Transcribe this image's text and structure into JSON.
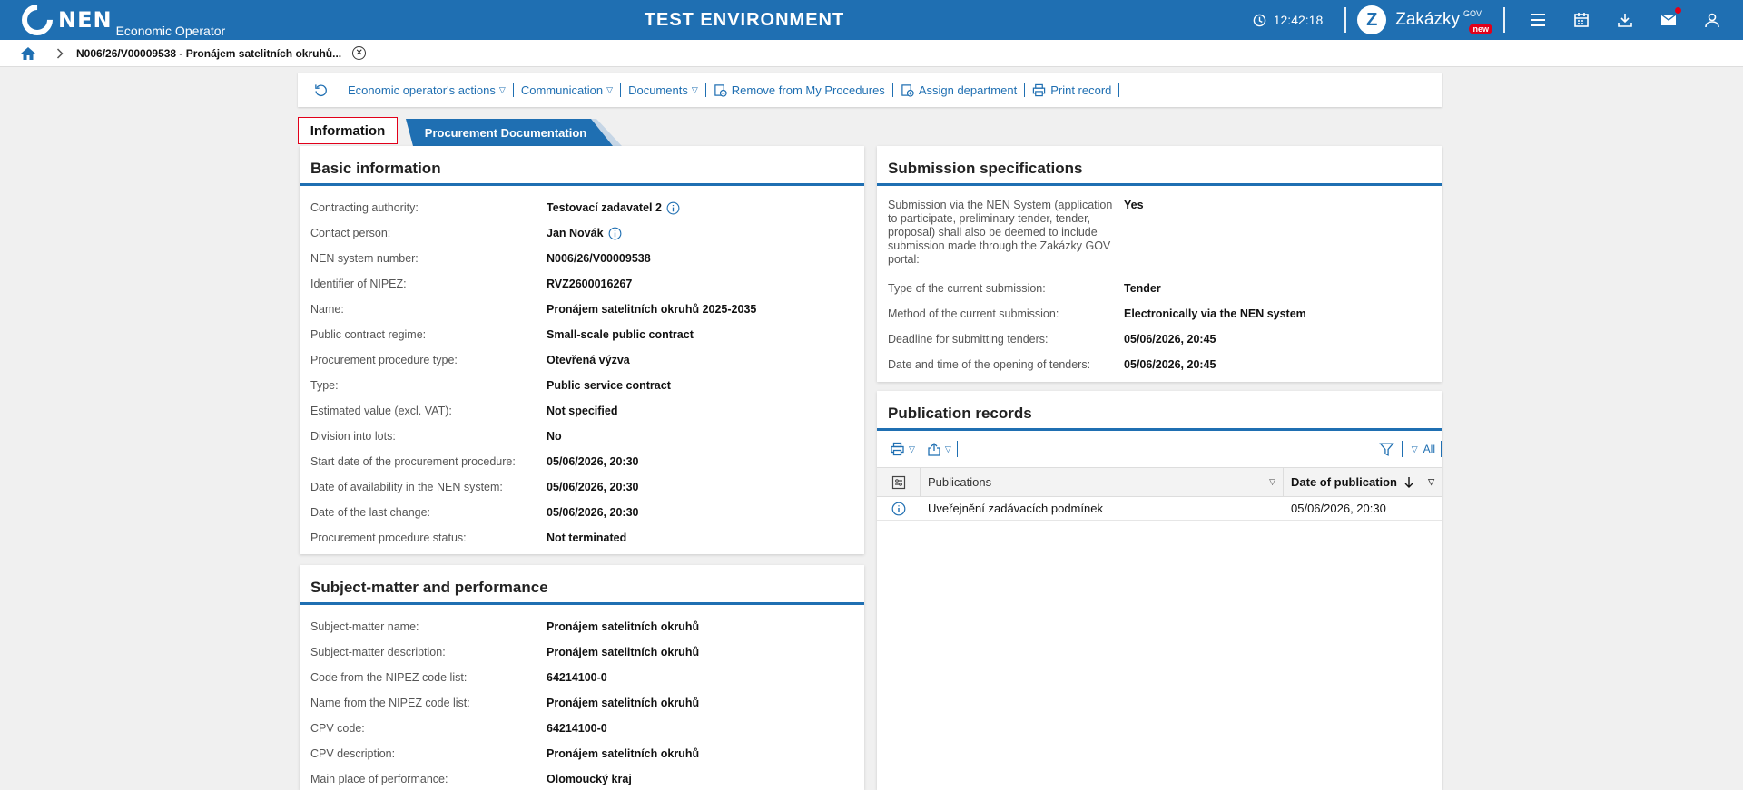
{
  "header": {
    "logo_text": "NEN",
    "logo_sub": "Economic Operator",
    "environment": "TEST ENVIRONMENT",
    "clock": "12:42:18",
    "zakazky_label": "Zakázky",
    "zakazky_gov": "GOV",
    "zakazky_badge": "new"
  },
  "breadcrumb": {
    "title": "N006/26/V00009538 - Pronájem satelitních okruhů..."
  },
  "toolbar": {
    "eo_actions": "Economic operator's actions",
    "communication": "Communication",
    "documents": "Documents",
    "remove": "Remove from My Procedures",
    "assign": "Assign department",
    "print": "Print record"
  },
  "tabs": {
    "information": "Information",
    "documentation": "Procurement Documentation"
  },
  "basic": {
    "title": "Basic information",
    "rows": [
      {
        "label": "Contracting authority:",
        "value": "Testovací zadavatel 2"
      },
      {
        "label": "Contact person:",
        "value": "Jan Novák"
      },
      {
        "label": "NEN system number:",
        "value": "N006/26/V00009538"
      },
      {
        "label": "Identifier of NIPEZ:",
        "value": "RVZ2600016267"
      },
      {
        "label": "Name:",
        "value": "Pronájem satelitních okruhů 2025-2035"
      },
      {
        "label": "Public contract regime:",
        "value": "Small-scale public contract"
      },
      {
        "label": "Procurement procedure type:",
        "value": "Otevřená výzva"
      },
      {
        "label": "Type:",
        "value": "Public service contract"
      },
      {
        "label": "Estimated value (excl. VAT):",
        "value": "Not specified"
      },
      {
        "label": "Division into lots:",
        "value": "No"
      },
      {
        "label": "Start date of the procurement procedure:",
        "value": "05/06/2026, 20:30"
      },
      {
        "label": "Date of availability in the NEN system:",
        "value": "05/06/2026, 20:30"
      },
      {
        "label": "Date of the last change:",
        "value": "05/06/2026, 20:30"
      },
      {
        "label": "Procurement procedure status:",
        "value": "Not terminated"
      }
    ]
  },
  "subject": {
    "title": "Subject-matter and performance",
    "rows": [
      {
        "label": "Subject-matter name:",
        "value": "Pronájem satelitních okruhů"
      },
      {
        "label": "Subject-matter description:",
        "value": "Pronájem satelitních okruhů"
      },
      {
        "label": "Code from the NIPEZ code list:",
        "value": "64214100-0"
      },
      {
        "label": "Name from the NIPEZ code list:",
        "value": "Pronájem satelitních okruhů"
      },
      {
        "label": "CPV code:",
        "value": "64214100-0"
      },
      {
        "label": "CPV description:",
        "value": "Pronájem satelitních okruhů"
      },
      {
        "label": "Main place of performance:",
        "value": "Olomoucký kraj"
      }
    ]
  },
  "submission": {
    "title": "Submission specifications",
    "rows": [
      {
        "label": "Submission via the NEN System (application to participate, preliminary tender, tender, proposal) shall also be deemed to include submission made through the Zakázky GOV portal:",
        "value": "Yes"
      },
      {
        "label": "Type of the current submission:",
        "value": "Tender"
      },
      {
        "label": "Method of the current submission:",
        "value": "Electronically via the NEN system"
      },
      {
        "label": "Deadline for submitting tenders:",
        "value": "05/06/2026, 20:45"
      },
      {
        "label": "Date and time of the opening of tenders:",
        "value": "05/06/2026, 20:45"
      }
    ]
  },
  "publications": {
    "title": "Publication records",
    "filter_label": "All",
    "col_publications": "Publications",
    "col_date": "Date of publication",
    "rows": [
      {
        "publication": "Uveřejnění zadávacích podmínek",
        "date": "05/06/2026, 20:30"
      }
    ]
  }
}
